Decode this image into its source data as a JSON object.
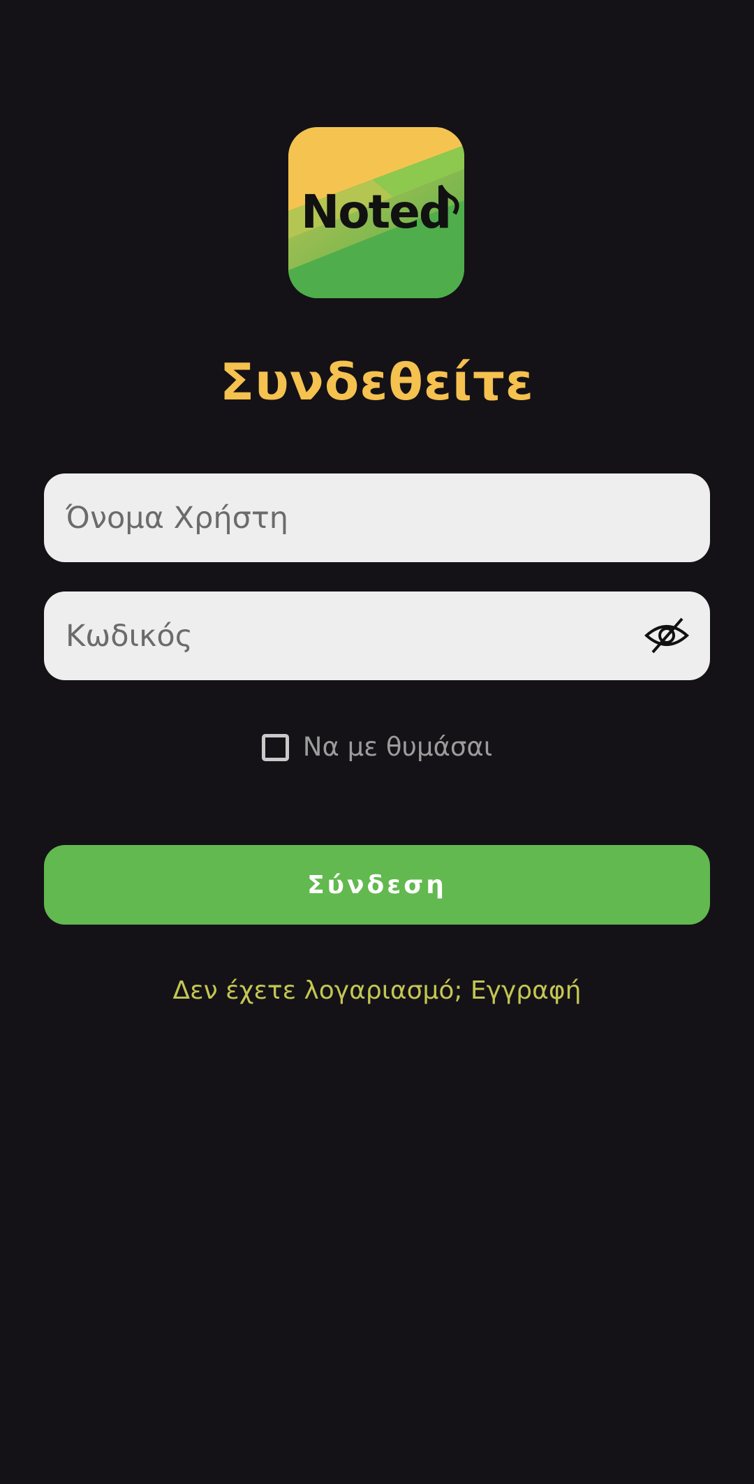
{
  "app": {
    "logo_text": "Noted",
    "brand_colors": {
      "yellow": "#f5c350",
      "green": "#4fae4b",
      "light_green": "#86c84f"
    }
  },
  "login": {
    "title": "Συνδεθείτε",
    "username_placeholder": "Όνομα Χρήστη",
    "username_value": "",
    "password_placeholder": "Κωδικός",
    "password_value": "",
    "password_toggle_icon": "eye-off-icon",
    "remember_me_label": "Να με θυμάσαι",
    "remember_me_checked": false,
    "submit_label": "Σύνδεση",
    "register_link": "Δεν έχετε λογαριασμό; Εγγραφή"
  },
  "theme": {
    "background": "#141217",
    "accent": "#f5c14f",
    "button": "#62b94f",
    "link": "#c4c653"
  }
}
